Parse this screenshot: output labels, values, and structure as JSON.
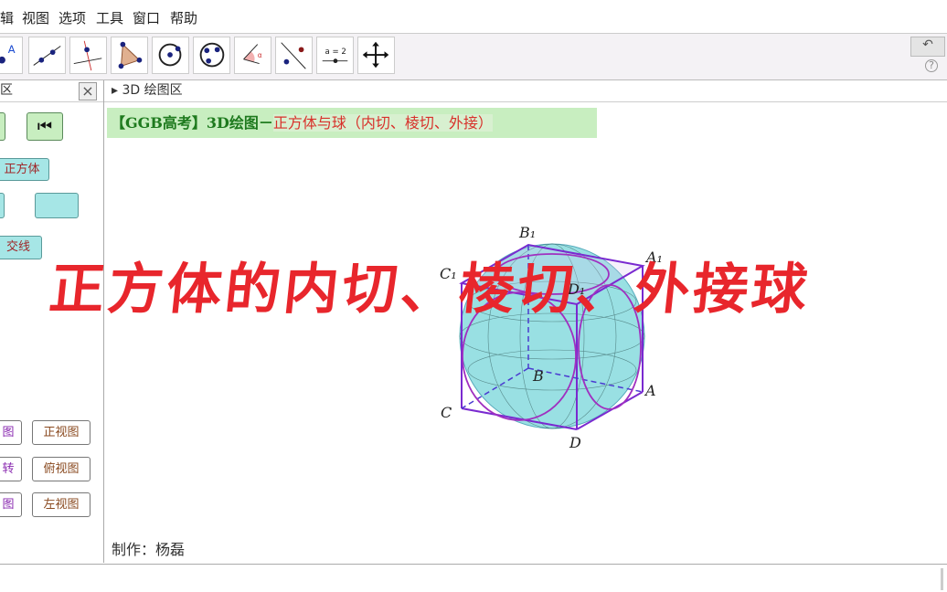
{
  "menu": [
    "辑",
    "视图",
    "选项",
    "工具",
    "窗口",
    "帮助"
  ],
  "toolbar": {
    "icons": [
      "point-tool",
      "line-tool",
      "perpendicular-tool",
      "polygon-tool",
      "circle-tool",
      "circle-three-points-tool",
      "angle-tool",
      "reflect-tool",
      "slider-tool",
      "move-view-tool"
    ],
    "slider_label": "a = 2",
    "point_label": "A",
    "angle_label": "α"
  },
  "left_panel": {
    "title": "区",
    "buttons": {
      "cube": "正方体",
      "intersection": "交线",
      "front_view": "正视图",
      "top_view": "俯视图",
      "left_view": "左视图",
      "view_a": "图",
      "rotate": "转",
      "view_b": "图"
    }
  },
  "main": {
    "header": "3D 绘图区",
    "banner_prefix": "【GGB高考】3D绘图－",
    "banner_topic": "正方体与球（内切、棱切、外接）",
    "overlay_title": "正方体的内切、棱切、外接球",
    "author": "制作：杨磊"
  },
  "labels": {
    "B1": "B₁",
    "A1": "A₁",
    "C1": "C₁",
    "D1": "D₁",
    "B": "B",
    "A": "A",
    "C": "C",
    "D": "D"
  },
  "colors": {
    "cube": "#7a2ad0",
    "sphere": "#7fd8dc",
    "title": "#e8262c"
  }
}
